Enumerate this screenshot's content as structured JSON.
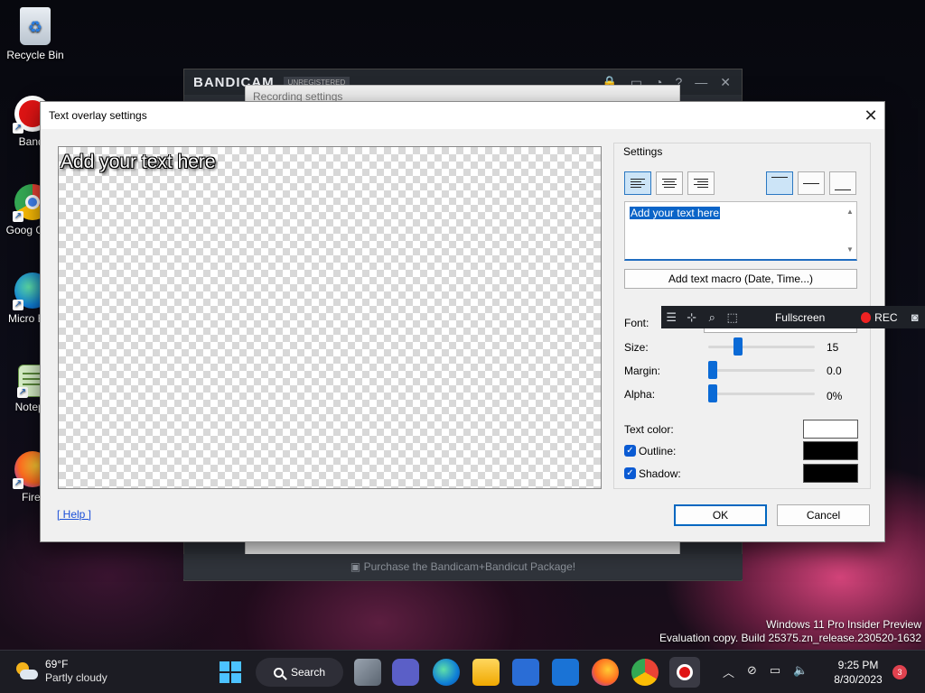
{
  "desktop": {
    "icons": [
      {
        "label": "Recycle Bin"
      },
      {
        "label": "Bandi"
      },
      {
        "label": "Goog Chro"
      },
      {
        "label": "Micro Edg"
      },
      {
        "label": "Notepa"
      },
      {
        "label": "Firef"
      }
    ]
  },
  "bandicam": {
    "logo": "BANDICAM",
    "badge": "UNREGISTERED",
    "recording_settings_title": "Recording settings",
    "purchase_text": "Purchase the Bandicam+Bandicut Package!"
  },
  "dialog": {
    "title": "Text overlay settings",
    "close_glyph": "✕",
    "preview_text": "Add your text here",
    "help_link": "[ Help ]",
    "ok_label": "OK",
    "cancel_label": "Cancel",
    "settings": {
      "legend": "Settings",
      "text_value": "Add your text here",
      "macro_button": "Add text macro (Date, Time...)",
      "font_label": "Font:",
      "size_label": "Size:",
      "size_value": "15",
      "margin_label": "Margin:",
      "margin_value": "0.0",
      "alpha_label": "Alpha:",
      "alpha_value": "0%",
      "text_color_label": "Text color:",
      "outline_label": "Outline:",
      "shadow_label": "Shadow:",
      "outline_checked": true,
      "shadow_checked": true,
      "colors": {
        "text": "#ffffff",
        "outline": "#000000",
        "shadow": "#000000"
      }
    }
  },
  "rec_toolbar": {
    "mode_label": "Fullscreen",
    "rec_label": "REC"
  },
  "watermark": {
    "line1": "Windows 11 Pro Insider Preview",
    "line2": "Evaluation copy. Build 25375.zn_release.230520-1632"
  },
  "taskbar": {
    "weather_temp": "69°F",
    "weather_condition": "Partly cloudy",
    "search_label": "Search",
    "time": "9:25 PM",
    "date": "8/30/2023",
    "notification_count": "3"
  }
}
